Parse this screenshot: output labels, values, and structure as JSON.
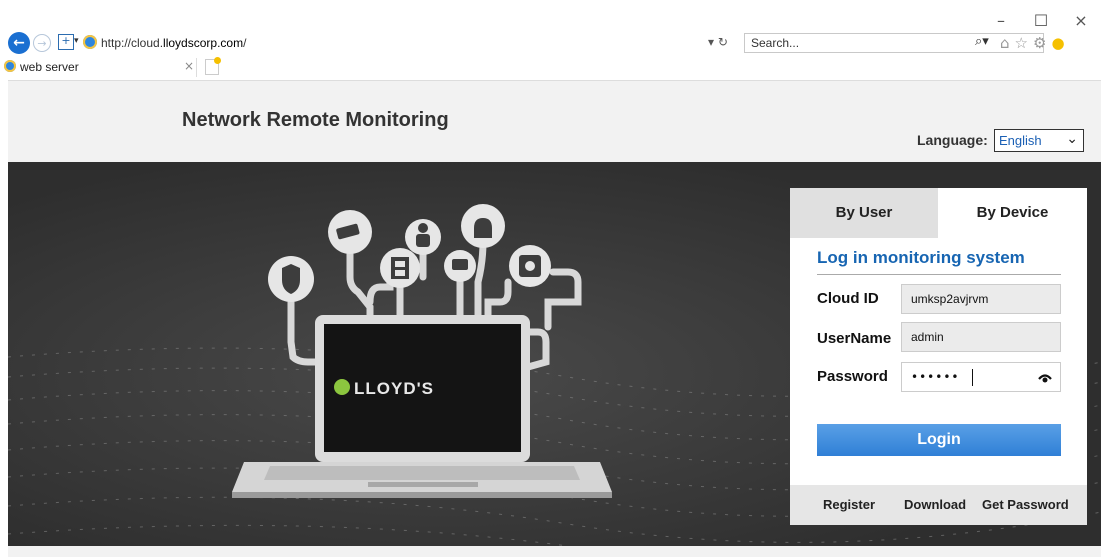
{
  "browser": {
    "url_prefix": "http://cloud.",
    "url_domain": "lloydscorp.com",
    "url_suffix": "/",
    "search_placeholder": "Search...",
    "tab_title": "web server",
    "window_controls": {
      "minimize": "–",
      "maximize": "☐",
      "close": "×"
    }
  },
  "header": {
    "title": "Network Remote Monitoring",
    "language_label": "Language:",
    "language_value": "English"
  },
  "login": {
    "tabs": [
      "By User",
      "By Device"
    ],
    "active_tab": "By Device",
    "title": "Log in monitoring system",
    "fields": {
      "cloud_id_label": "Cloud ID",
      "cloud_id_value": "umksp2avjrvm",
      "username_label": "UserName",
      "username_value": "admin",
      "password_label": "Password",
      "password_masked": "••••••"
    },
    "login_button": "Login",
    "footer_links": [
      "Register",
      "Download",
      "Get Password"
    ]
  },
  "hero": {
    "brand_text": "LLOYD'S",
    "icons": [
      "shield-icon",
      "security-camera-icon",
      "user-icon",
      "alarm-icon",
      "film-icon",
      "message-icon",
      "hard-drive-icon"
    ]
  },
  "colors": {
    "accent": "#1765b2",
    "login_button": "#2f7fd6",
    "hero_background": "#3d3d3d"
  }
}
